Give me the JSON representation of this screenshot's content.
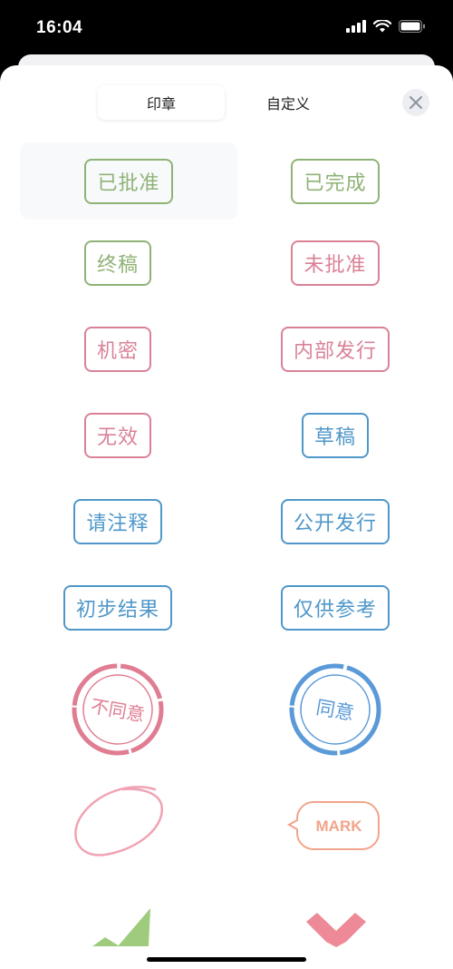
{
  "status_bar": {
    "time": "16:04"
  },
  "tabs": [
    {
      "label": "印章",
      "active": true
    },
    {
      "label": "自定义",
      "active": false
    }
  ],
  "close_icon": "close-icon",
  "stamps": [
    {
      "label": "已批准",
      "color": "green"
    },
    {
      "label": "已完成",
      "color": "green"
    },
    {
      "label": "终稿",
      "color": "green"
    },
    {
      "label": "未批准",
      "color": "pink"
    },
    {
      "label": "机密",
      "color": "pink"
    },
    {
      "label": "内部发行",
      "color": "pink"
    },
    {
      "label": "无效",
      "color": "pink"
    },
    {
      "label": "草稿",
      "color": "blue"
    },
    {
      "label": "请注释",
      "color": "blue"
    },
    {
      "label": "公开发行",
      "color": "blue"
    },
    {
      "label": "初步结果",
      "color": "blue"
    },
    {
      "label": "仅供参考",
      "color": "blue"
    }
  ],
  "round_stamps": [
    {
      "label": "不同意",
      "color": "#e07d92"
    },
    {
      "label": "同意",
      "color": "#5a9ad8"
    }
  ],
  "shape_stamps": [
    {
      "icon": "ellipse-stamp-icon",
      "color": "#f0a3b3"
    },
    {
      "label": "MARK",
      "color": "#f2a48a"
    }
  ],
  "partial_stamps": [
    {
      "icon": "checkmark-stamp-icon",
      "color": "#9fcb7d"
    },
    {
      "icon": "cross-stamp-icon",
      "color": "#ee8a97"
    }
  ],
  "colors": {
    "green": "#8fb276",
    "pink": "#d98296",
    "blue": "#4f97c9"
  }
}
